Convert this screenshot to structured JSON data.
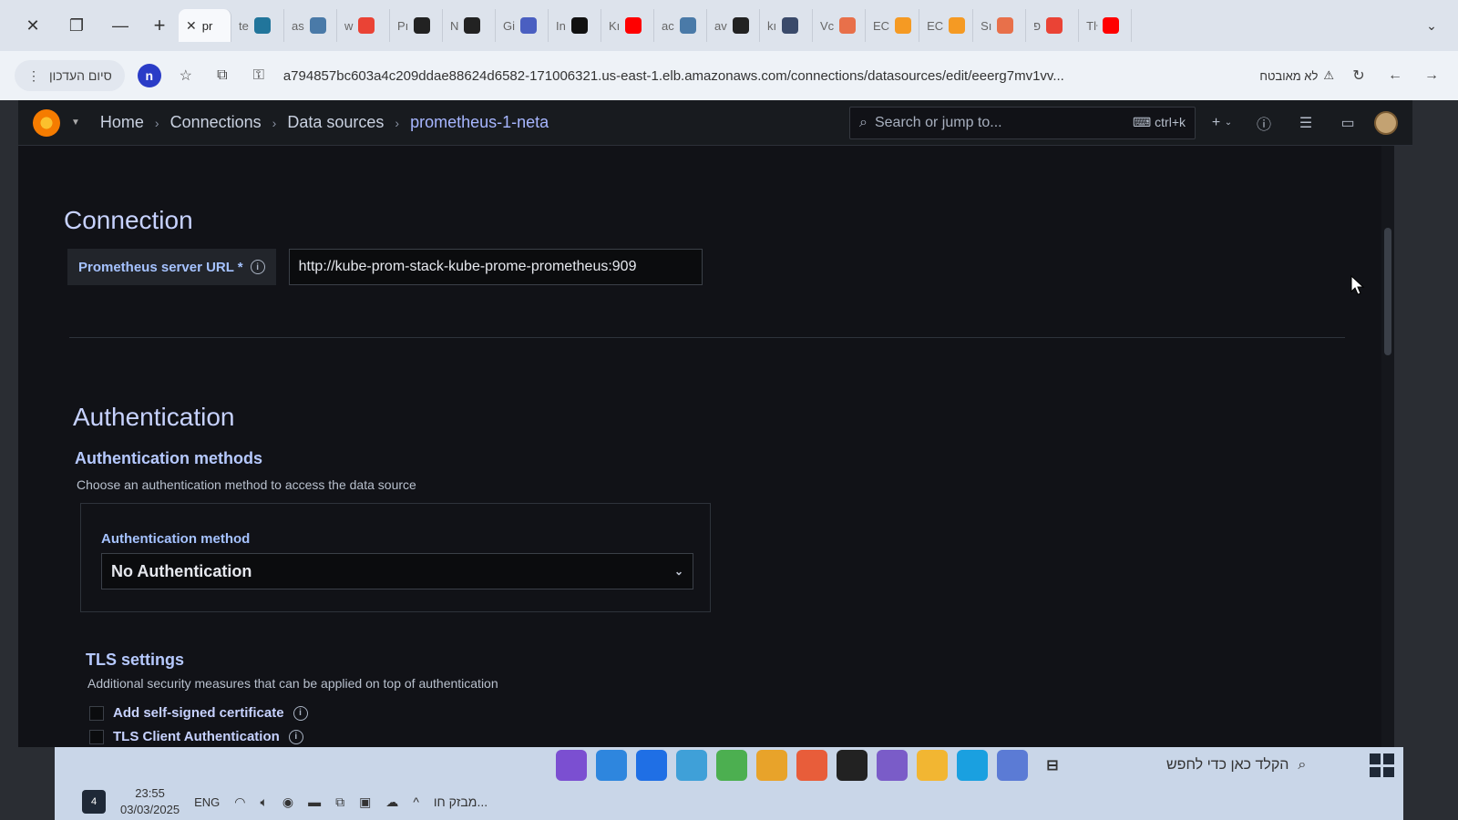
{
  "browser": {
    "tabs": [
      {
        "label": "pr",
        "color": "#ffffff",
        "active": true
      },
      {
        "label": "te",
        "color": "#21759b"
      },
      {
        "label": "as",
        "color": "#4a7aa8"
      },
      {
        "label": "w",
        "color": "#ea4335"
      },
      {
        "label": "Pı",
        "color": "#222222"
      },
      {
        "label": "N",
        "color": "#222222"
      },
      {
        "label": "Gi",
        "color": "#4a5fc1"
      },
      {
        "label": "In",
        "color": "#111111"
      },
      {
        "label": "Kı",
        "color": "#ff0000"
      },
      {
        "label": "ac",
        "color": "#4a7aa8"
      },
      {
        "label": "av",
        "color": "#222222"
      },
      {
        "label": "kı",
        "color": "#3a4a6a"
      },
      {
        "label": "Vc",
        "color": "#e8704a"
      },
      {
        "label": "EC",
        "color": "#f59a23"
      },
      {
        "label": "EC",
        "color": "#f59a23"
      },
      {
        "label": "Sı",
        "color": "#e8704a"
      },
      {
        "label": "פ",
        "color": "#ea4335"
      },
      {
        "label": "Tŀ",
        "color": "#ff0000"
      }
    ],
    "update_label": "סיום העדכון",
    "profile_initial": "n",
    "url": "a794857bc603a4c209ddae88624d6582-171006321.us-east-1.elb.amazonaws.com/connections/datasources/edit/eeerg7mv1vv...",
    "insecure_label": "לא מאובטח"
  },
  "grafana": {
    "breadcrumbs": [
      "Home",
      "Connections",
      "Data sources",
      "prometheus-1-neta"
    ],
    "search_placeholder": "Search or jump to...",
    "search_shortcut": "ctrl+k",
    "add_label": "+"
  },
  "connection": {
    "title": "Connection",
    "url_label": "Prometheus server URL *",
    "url_value": "http://kube-prom-stack-kube-prome-prometheus:909"
  },
  "authentication": {
    "title": "Authentication",
    "methods_heading": "Authentication methods",
    "methods_desc": "Choose an authentication method to access the data source",
    "method_label": "Authentication method",
    "method_value": "No Authentication"
  },
  "tls": {
    "heading": "TLS settings",
    "desc": "Additional security measures that can be applied on top of authentication",
    "options": [
      "Add self-signed certificate",
      "TLS Client Authentication"
    ]
  },
  "taskbar": {
    "search_label": "הקלד כאן כדי לחפש",
    "folder_label": "מבזק חו...",
    "lang": "ENG",
    "time": "23:55",
    "date": "03/03/2025",
    "notification_count": "4"
  }
}
